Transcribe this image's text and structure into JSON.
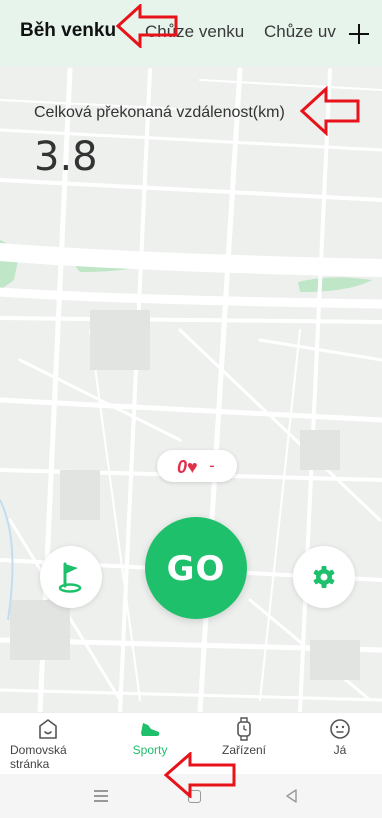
{
  "tabs": [
    {
      "label": "Běh venku",
      "active": true
    },
    {
      "label": "Chůze venku",
      "active": false
    },
    {
      "label": "Chůze uv",
      "active": false
    }
  ],
  "add_icon": "plus-icon",
  "distance": {
    "label": "Celková překonaná vzdálenost(km)",
    "value": "3.8"
  },
  "heart_rate": {
    "icon": "heart-rate-icon",
    "value": "-"
  },
  "controls": {
    "go_label": "GO",
    "flag_icon": "flag-icon",
    "settings_icon": "gear-icon"
  },
  "bottom_nav": [
    {
      "label": "Domovská stránka",
      "icon": "home-icon",
      "active": false
    },
    {
      "label": "Sporty",
      "icon": "shoe-icon",
      "active": true
    },
    {
      "label": "Zařízení",
      "icon": "watch-icon",
      "active": false
    },
    {
      "label": "Já",
      "icon": "smiley-icon",
      "active": false
    }
  ],
  "system_nav": [
    "menu-icon",
    "home-square-icon",
    "back-triangle-icon"
  ],
  "colors": {
    "accent": "#1fc06c",
    "tab_bar_bg": "#e6f4ec",
    "heart": "#e0304a",
    "annotation": "#e8121a"
  }
}
